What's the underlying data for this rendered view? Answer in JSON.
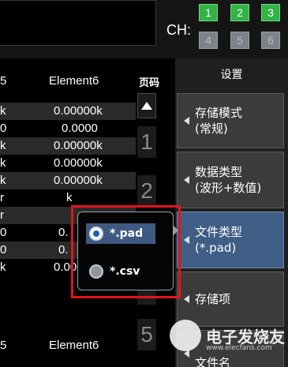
{
  "channels": {
    "label": "CH:",
    "buttons": [
      {
        "label": "1",
        "active": true
      },
      {
        "label": "2",
        "active": true
      },
      {
        "label": "3",
        "active": true
      },
      {
        "label": "4",
        "active": false
      },
      {
        "label": "5",
        "active": false
      },
      {
        "label": "6",
        "active": false
      }
    ]
  },
  "table": {
    "header": {
      "col1": "5",
      "col2": "Element6"
    },
    "rows": [
      {
        "c1": "k",
        "c2": "0.00000k"
      },
      {
        "c1": "0",
        "c2": "0.0000"
      },
      {
        "c1": "k",
        "c2": "0.00000k"
      },
      {
        "c1": "k",
        "c2": "0.00000k"
      },
      {
        "c1": "k",
        "c2": "0.00000k"
      },
      {
        "c1": "r",
        "c2": "k"
      },
      {
        "c1": "r",
        "c2": ""
      },
      {
        "c1": "0",
        "c2": "0."
      },
      {
        "c1": "0",
        "c2": "0."
      },
      {
        "c1": "k",
        "c2": "0.00000k"
      }
    ],
    "footer_header": {
      "col1": "5",
      "col2": "Element6"
    }
  },
  "pager": {
    "title": "页码",
    "up_icon": "triangle-up-icon",
    "pages": [
      "1",
      "2",
      "",
      "",
      "5"
    ]
  },
  "menu": {
    "title": "设置",
    "items": [
      {
        "line1": "存储模式",
        "line2": "(常规)"
      },
      {
        "line1": "数据类型",
        "line2": "(波形+数值)"
      },
      {
        "line1": "文件类型",
        "line2": "(*.pad)"
      },
      {
        "line1": "存储项",
        "line2": ""
      },
      {
        "line1": "文件名",
        "line2": ""
      }
    ]
  },
  "popup": {
    "options": [
      {
        "label": "*.pad",
        "selected": true
      },
      {
        "label": "*.csv",
        "selected": false
      }
    ]
  },
  "watermark": {
    "text": "电子发烧友",
    "url": "www.elecfans.com"
  },
  "colors": {
    "channel_active": "#2fb445",
    "channel_inactive": "#7c8288",
    "menu_active": "#3f5e86",
    "highlight_frame": "#e0161c"
  }
}
